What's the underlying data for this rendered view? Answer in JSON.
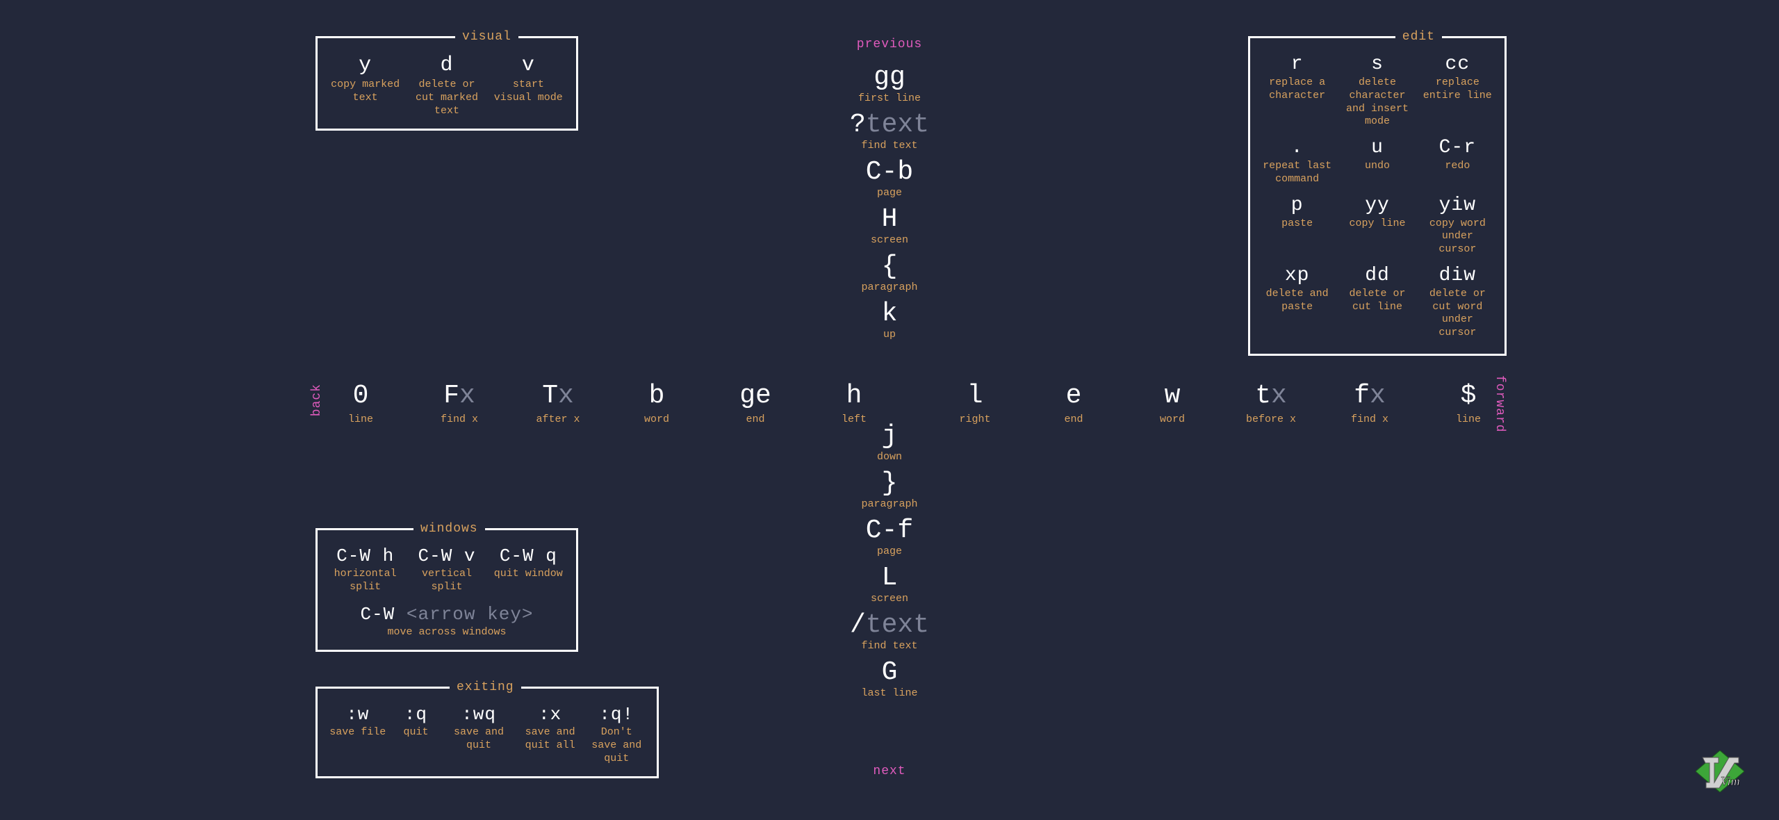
{
  "visual": {
    "title": "visual",
    "items": [
      {
        "key": "y",
        "desc": "copy marked text"
      },
      {
        "key": "d",
        "desc": "delete or cut marked text"
      },
      {
        "key": "v",
        "desc": "start visual mode"
      }
    ]
  },
  "edit": {
    "title": "edit",
    "rows": [
      [
        {
          "key": "r",
          "desc": "replace a character"
        },
        {
          "key": "s",
          "desc": "delete character and insert mode"
        },
        {
          "key": "cc",
          "desc": "replace entire line"
        }
      ],
      [
        {
          "key": ".",
          "desc": "repeat last command"
        },
        {
          "key": "u",
          "desc": "undo"
        },
        {
          "key": "C-r",
          "desc": "redo"
        }
      ],
      [
        {
          "key": "p",
          "desc": "paste"
        },
        {
          "key": "yy",
          "desc": "copy line"
        },
        {
          "key": "yiw",
          "desc": "copy word under cursor"
        }
      ],
      [
        {
          "key": "xp",
          "desc": "delete and paste"
        },
        {
          "key": "dd",
          "desc": "delete or cut line"
        },
        {
          "key": "diw",
          "desc": "delete or cut word under cursor"
        }
      ]
    ]
  },
  "windows": {
    "title": "windows",
    "row1": [
      {
        "key": "C-W h",
        "desc": "horizontal split"
      },
      {
        "key": "C-W v",
        "desc": "vertical split"
      },
      {
        "key": "C-W q",
        "desc": "quit window"
      }
    ],
    "row2": {
      "key_pre": "C-W ",
      "key_post": "<arrow key>",
      "desc": "move across windows"
    }
  },
  "exiting": {
    "title": "exiting",
    "items": [
      {
        "key": ":w",
        "desc": "save file"
      },
      {
        "key": ":q",
        "desc": "quit"
      },
      {
        "key": ":wq",
        "desc": "save and quit"
      },
      {
        "key": ":x",
        "desc": "save and quit all"
      },
      {
        "key": ":q!",
        "desc": "Don't save and quit"
      }
    ]
  },
  "axes": {
    "previous": "previous",
    "next": "next",
    "back": "back",
    "forward": "forward"
  },
  "vertical_up": [
    {
      "key": "gg",
      "desc": "first line"
    },
    {
      "key_pre": "?",
      "key_post": "text",
      "desc": "find text"
    },
    {
      "key": "C-b",
      "desc": "page"
    },
    {
      "key": "H",
      "desc": "screen"
    },
    {
      "key": "{",
      "desc": "paragraph"
    },
    {
      "key": "k",
      "desc": "up"
    }
  ],
  "vertical_down": [
    {
      "key": "j",
      "desc": "down"
    },
    {
      "key": "}",
      "desc": "paragraph"
    },
    {
      "key": "C-f",
      "desc": "page"
    },
    {
      "key": "L",
      "desc": "screen"
    },
    {
      "key_pre": "/",
      "key_post": "text",
      "desc": "find text"
    },
    {
      "key": "G",
      "desc": "last line"
    }
  ],
  "horizontal_left": [
    {
      "key": "0",
      "desc": "line"
    },
    {
      "key_pre": "F",
      "key_post": "x",
      "desc": "find x"
    },
    {
      "key_pre": "T",
      "key_post": "x",
      "desc": "after x"
    },
    {
      "key": "b",
      "desc": "word"
    },
    {
      "key": "ge",
      "desc": "end"
    },
    {
      "key": "h",
      "desc": "left"
    }
  ],
  "horizontal_right": [
    {
      "key": "l",
      "desc": "right"
    },
    {
      "key": "e",
      "desc": "end"
    },
    {
      "key": "w",
      "desc": "word"
    },
    {
      "key_pre": "t",
      "key_post": "x",
      "desc": "before x"
    },
    {
      "key_pre": "f",
      "key_post": "x",
      "desc": "find x"
    },
    {
      "key": "$",
      "desc": "line"
    }
  ],
  "logo_text": "Vim"
}
